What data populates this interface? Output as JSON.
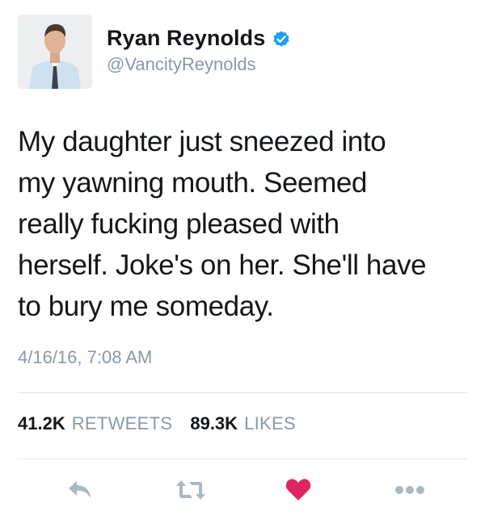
{
  "user": {
    "display_name": "Ryan Reynolds",
    "handle": "@VancityReynolds",
    "verified": true
  },
  "tweet": {
    "text_lines": [
      "My daughter just sneezed into",
      "my yawning mouth. Seemed",
      "really fucking pleased with",
      "herself. Joke's on her. She'll have",
      "to bury me someday."
    ],
    "timestamp": "4/16/16, 7:08 AM"
  },
  "stats": {
    "retweets_count": "41.2K",
    "retweets_label": "RETWEETS",
    "likes_count": "89.3K",
    "likes_label": "LIKES"
  },
  "actions": [
    {
      "icon": "reply-icon"
    },
    {
      "icon": "retweet-icon"
    },
    {
      "icon": "heart-icon",
      "active": true
    },
    {
      "icon": "more-icon"
    }
  ],
  "colors": {
    "text": "#14171a",
    "muted": "#8899a6",
    "divider": "#e1e8ed",
    "verified": "#1da1f2",
    "like": "#e0245e",
    "action": "#aab8c2"
  }
}
